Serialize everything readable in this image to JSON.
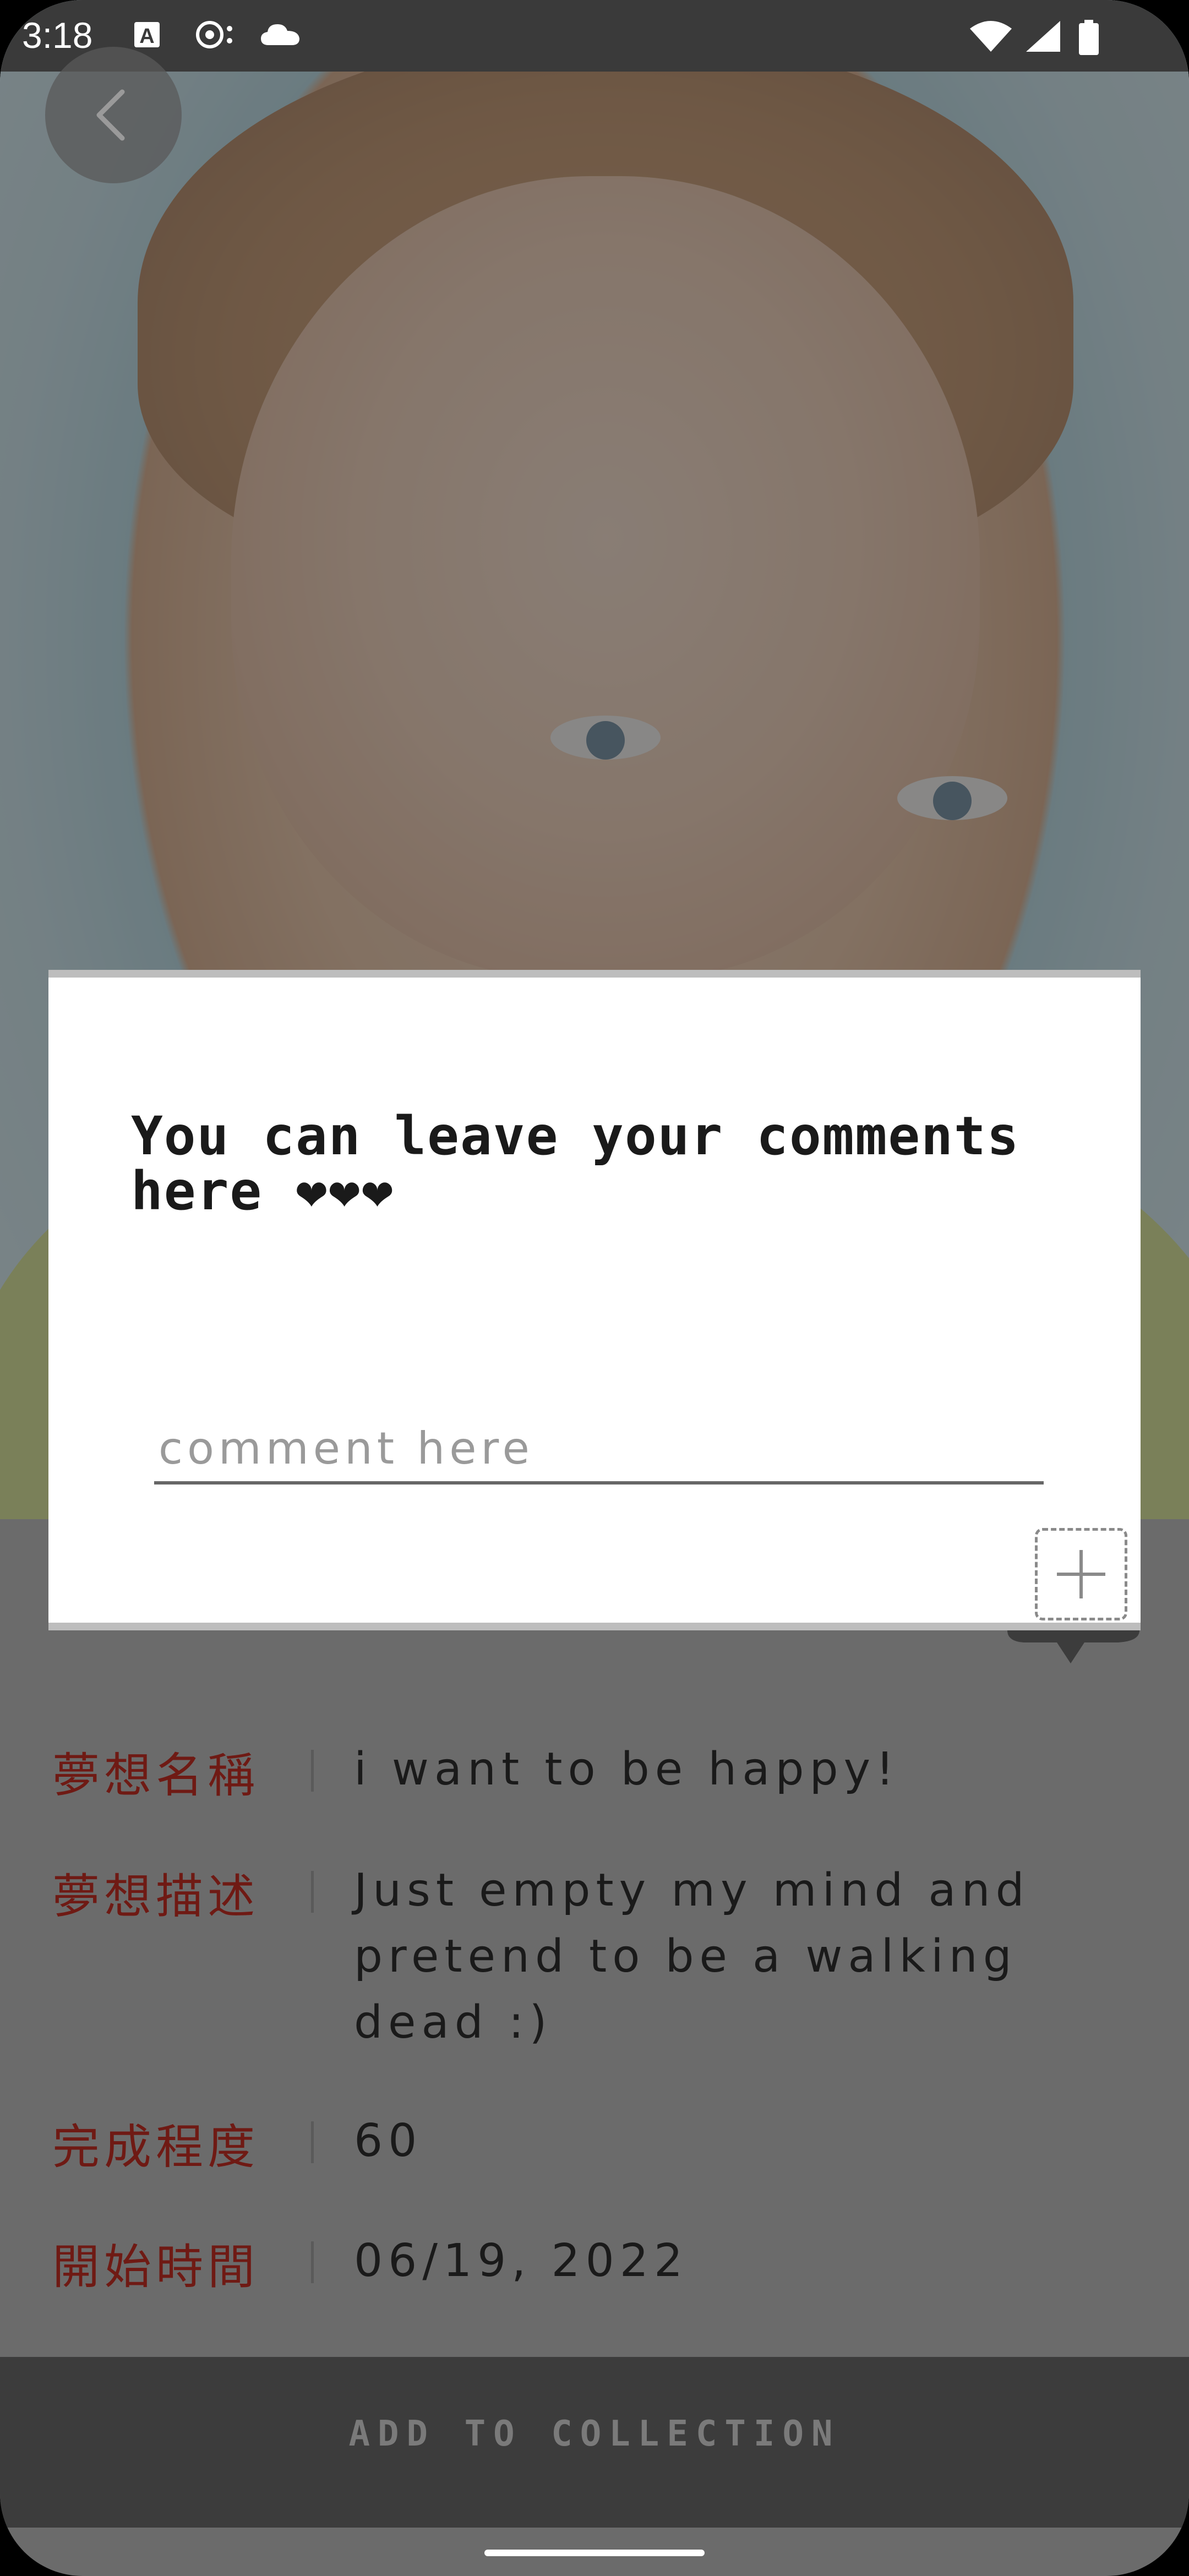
{
  "status_bar": {
    "time": "3:18",
    "icons": [
      "a-text-icon",
      "mic-sync-icon",
      "cloud-icon",
      "wifi-icon",
      "signal-icon",
      "battery-icon"
    ]
  },
  "nav": {
    "back_icon": "chevron-left-icon"
  },
  "dialog": {
    "title": "You can leave your comments here ❤❤❤",
    "input_placeholder": "comment here",
    "input_value": "",
    "add_icon": "plus-icon"
  },
  "details": {
    "rows": [
      {
        "label": "夢想名稱",
        "value": "i want to be happy!"
      },
      {
        "label": "夢想描述",
        "value": "Just empty my mind and pretend to be a walking dead :)"
      },
      {
        "label": "完成程度",
        "value": "60"
      },
      {
        "label": "開始時間",
        "value": "06/19, 2022"
      }
    ]
  },
  "bottom_button": {
    "label": "ADD TO COLLECTION"
  },
  "colors": {
    "label_red": "#6f1a14",
    "overlay": "#6b6b6b",
    "dialog_bg": "#ffffff"
  }
}
